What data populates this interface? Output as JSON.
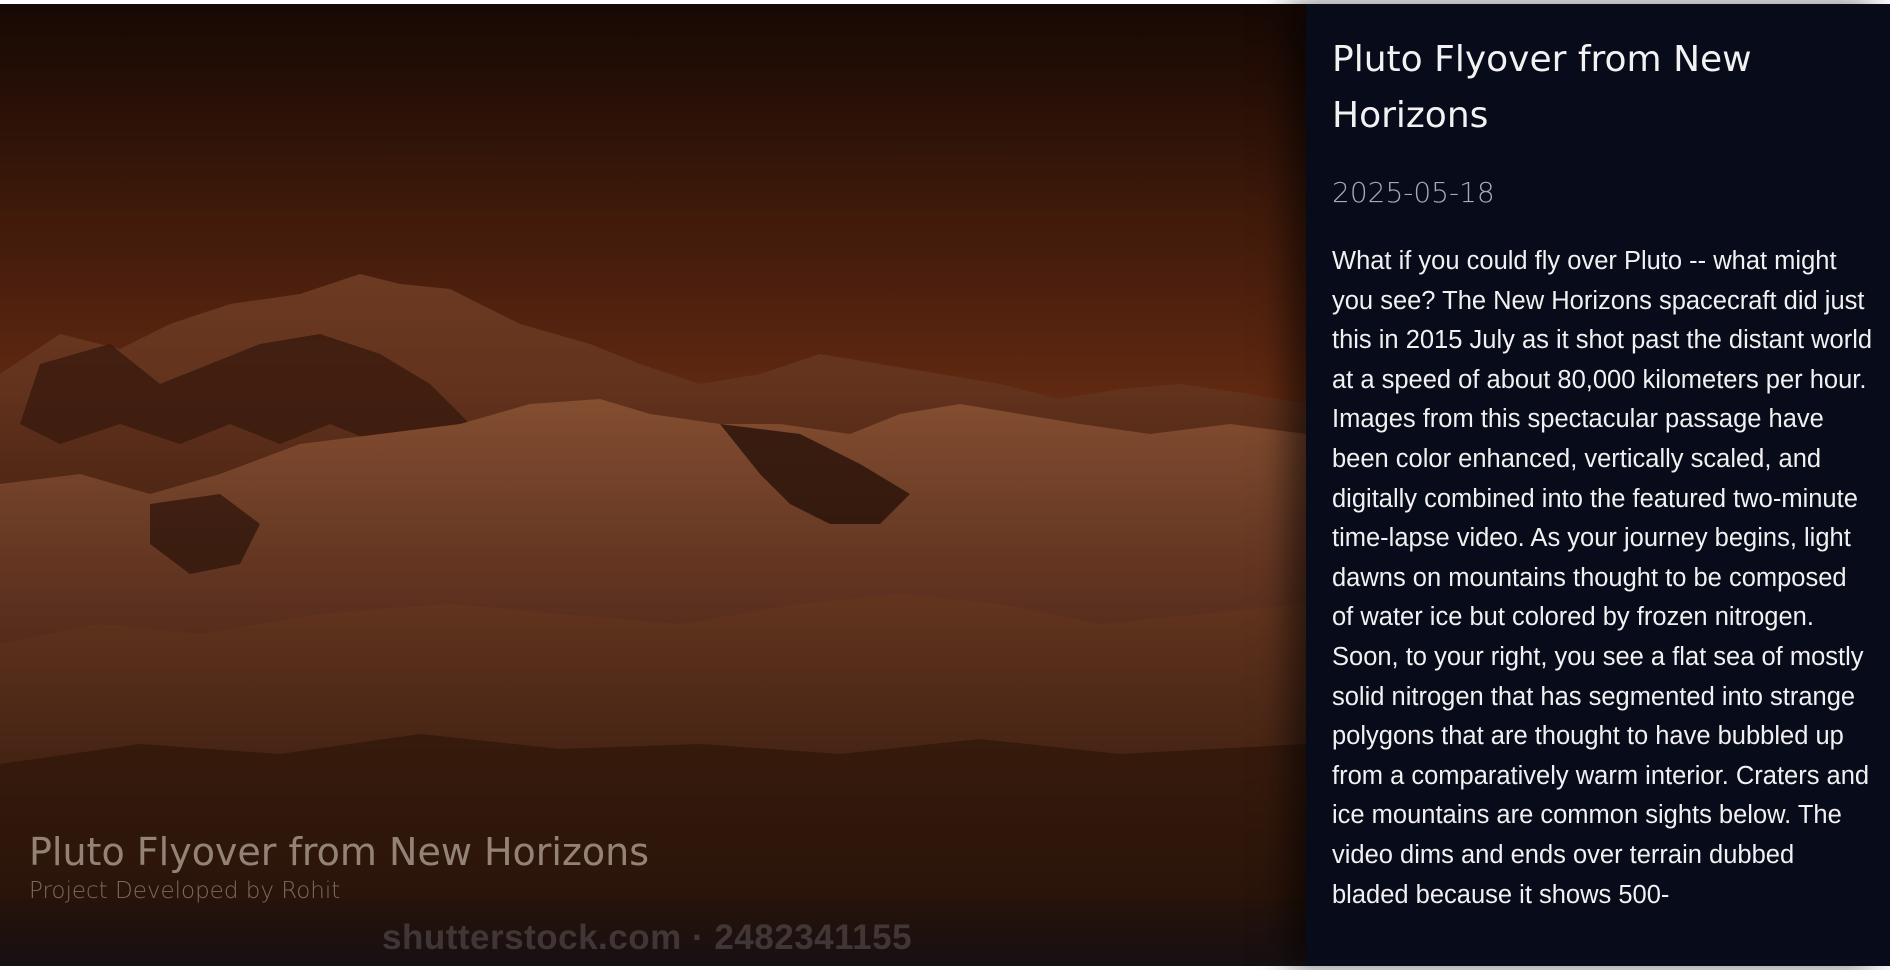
{
  "background": {
    "watermark": "shutterstock.com · 2482341155"
  },
  "caption": {
    "title": "Pluto Flyover from New Horizons",
    "credit": "Project Developed by Rohit"
  },
  "panel": {
    "title": "Pluto Flyover from New Horizons",
    "date": "2025-05-18",
    "explanation": "What if you could fly over Pluto -- what might you see? The New Horizons spacecraft did just this in 2015 July as it shot past the distant world at a speed of about 80,000 kilometers per hour. Images from this spectacular passage have been color enhanced, vertically scaled, and digitally combined into the featured two-minute time-lapse video. As your journey begins, light dawns on mountains thought to be composed of water ice but colored by frozen nitrogen. Soon, to your right, you see a flat sea of mostly solid nitrogen that has segmented into strange polygons that are thought to have bubbled up from a comparatively warm interior. Craters and ice mountains are common sights below. The video dims and ends over terrain dubbed bladed because it shows 500-"
  },
  "colors": {
    "panel_background": "#070b1a",
    "panel_text": "#f1f1f1",
    "date_text": "#a7a9b3"
  }
}
